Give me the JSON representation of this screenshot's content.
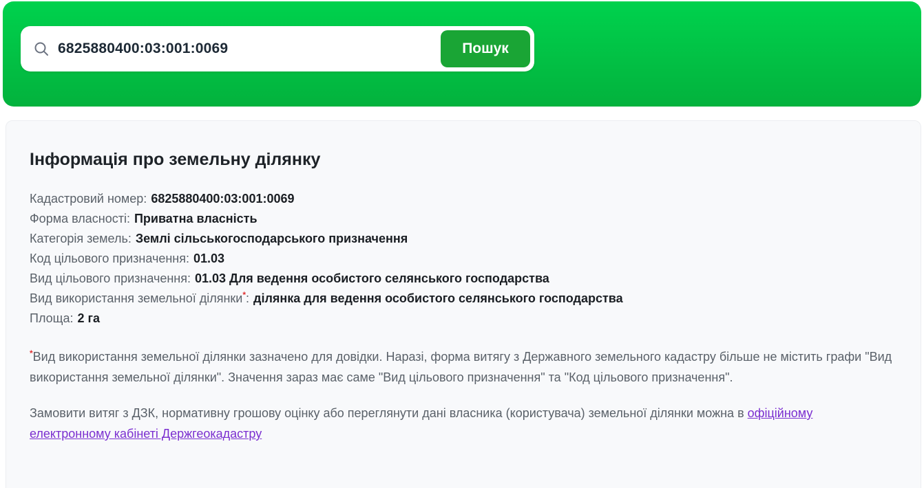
{
  "header": {
    "search": {
      "value": "6825880400:03:001:0069",
      "button_label": "Пошук",
      "icon": "magnifier-icon"
    }
  },
  "info": {
    "title": "Інформація про земельну ділянку",
    "rows": [
      {
        "label": "Кадастровий номер",
        "sup": "",
        "sep": ":",
        "value": "6825880400:03:001:0069"
      },
      {
        "label": "Форма власності",
        "sup": "",
        "sep": ":",
        "value": "Приватна власність"
      },
      {
        "label": "Категорія земель",
        "sup": "",
        "sep": ":",
        "value": "Землі сільськогосподарського призначення"
      },
      {
        "label": "Код цільового призначення",
        "sup": "",
        "sep": ":",
        "value": "01.03"
      },
      {
        "label": "Вид цільового призначення",
        "sup": "",
        "sep": ":",
        "value": "01.03 Для ведення особистого селянського господарства"
      },
      {
        "label": "Вид використання земельної ділянки",
        "sup": "*",
        "sep": ":",
        "value": "ділянка для ведення особистого селянського господарства"
      },
      {
        "label": "Площа",
        "sup": "",
        "sep": ":",
        "value": "2 га"
      }
    ],
    "footnote": {
      "marker": "*",
      "text": "Вид використання земельної ділянки зазначено для довідки. Наразі, форма витягу з Державного земельного кадастру більше не містить графи \"Вид використання земельної ділянки\". Значення зараз має саме \"Вид цільового призначення\" та \"Код цільового призначення\"."
    },
    "order": {
      "text": "Замовити витяг з ДЗК, нормативну грошову оцінку або переглянути дані власника (користувача) земельної ділянки можна в",
      "link_label": "офіційному електронному кабінеті Держгеокадастру"
    }
  },
  "colors": {
    "header_gradient_top": "#00d24d",
    "header_gradient_bottom": "#03b23d",
    "search_button_green": "#1aa535",
    "link_purple": "#7b2fd0",
    "asterisk_red": "#e03131",
    "label_gray": "#5a6169",
    "value_dark": "#1a1e23",
    "card_background": "#f8f9fb"
  }
}
